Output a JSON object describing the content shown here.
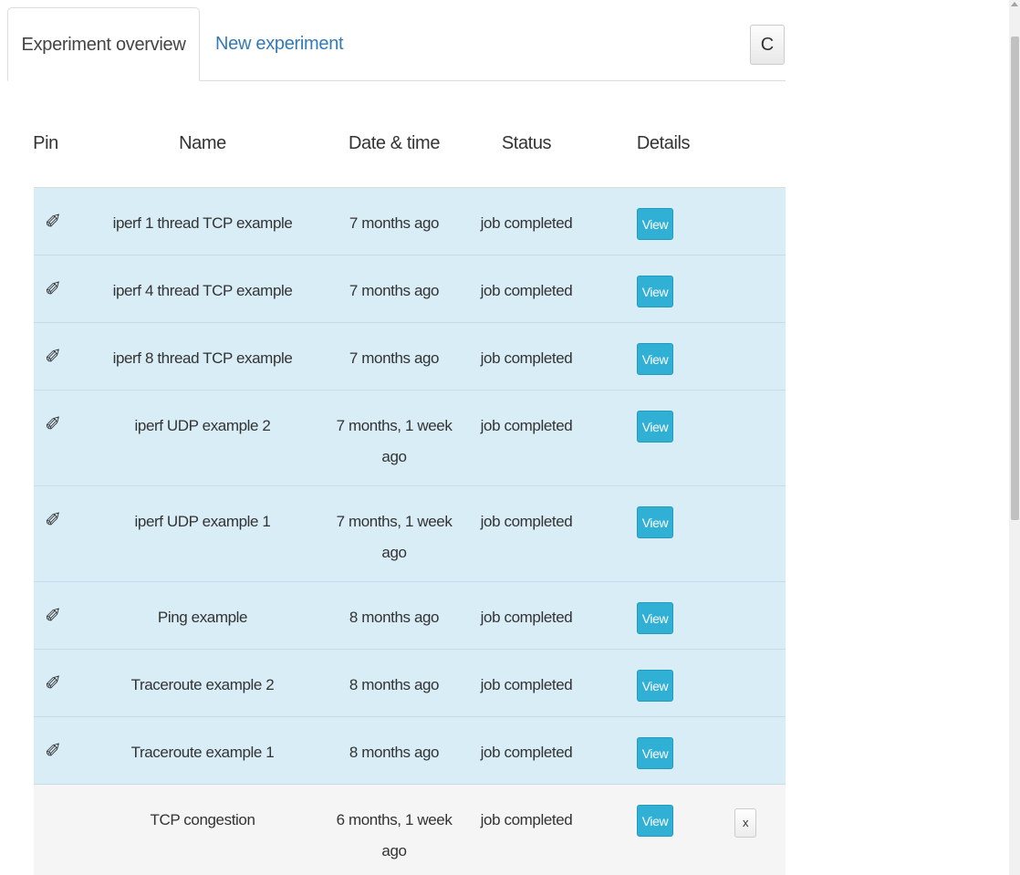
{
  "tabs": [
    {
      "label": "Experiment overview",
      "active": true
    },
    {
      "label": "New experiment",
      "active": false
    }
  ],
  "refresh_button": {
    "label": "C",
    "icon": "refresh-icon"
  },
  "table": {
    "headers": {
      "pin": "Pin",
      "name": "Name",
      "date": "Date & time",
      "status": "Status",
      "details": "Details"
    },
    "view_label": "View",
    "delete_label": "x",
    "rows": [
      {
        "pinned": true,
        "pin_icon": "✐",
        "name": "iperf 1 thread TCP example",
        "date": "7 months ago",
        "status": "job completed"
      },
      {
        "pinned": true,
        "pin_icon": "✐",
        "name": "iperf 4 thread TCP example",
        "date": "7 months ago",
        "status": "job completed"
      },
      {
        "pinned": true,
        "pin_icon": "✐",
        "name": "iperf 8 thread TCP example",
        "date": "7 months ago",
        "status": "job completed"
      },
      {
        "pinned": true,
        "pin_icon": "✐",
        "name": "iperf UDP example 2",
        "date": "7 months, 1 week ago",
        "status": "job completed"
      },
      {
        "pinned": true,
        "pin_icon": "✐",
        "name": "iperf UDP example 1",
        "date": "7 months, 1 week ago",
        "status": "job completed"
      },
      {
        "pinned": true,
        "pin_icon": "✐",
        "name": "Ping example",
        "date": "8 months ago",
        "status": "job completed"
      },
      {
        "pinned": true,
        "pin_icon": "✐",
        "name": "Traceroute example 2",
        "date": "8 months ago",
        "status": "job completed"
      },
      {
        "pinned": true,
        "pin_icon": "✐",
        "name": "Traceroute example 1",
        "date": "8 months ago",
        "status": "job completed"
      },
      {
        "pinned": false,
        "pin_icon": "",
        "name": "TCP congestion",
        "date": "6 months, 1 week ago",
        "status": "job completed"
      }
    ]
  },
  "colors": {
    "pinned_row": "#d9edf7",
    "unpinned_row": "#f5f5f5",
    "view_button": "#31b0d5",
    "tab_link": "#337ab7"
  }
}
